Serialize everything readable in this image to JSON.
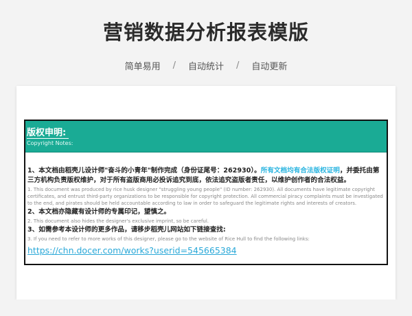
{
  "header": {
    "title": "营销数据分析报表模版",
    "subtitle_items": [
      "简单易用",
      "自动统计",
      "自动更新"
    ],
    "separator": "/"
  },
  "notice": {
    "banner_title": "版权申明:",
    "banner_subtitle": "Copyright Notes:",
    "line1_cn_pre": "1、本文档由稻壳儿设计师\"奋斗的小青年\"制作完成（身份证尾号：262930）。",
    "line1_cn_link": "所有文档均有合法版权证明",
    "line1_cn_post": "，并委托由第三方机构负责版权维护，对于所有盗版商用必投诉追究到底，依法追究盗版者责任，以维护创作者的合法权益。",
    "line1_en": "1. This document was produced by rice husk designer \"struggling young people\" (ID number: 262930). All documents have legitimate copyright certificates, and entrust third-party organizations to be responsible for copyright protection. All commercial piracy complaints must be investigated to the end, and pirates should be held accountable according to law in order to safeguard the legitimate rights and interests of creators.",
    "line2_cn": "2、本文档亦隐藏有设计师的专属印记，望慎之。",
    "line2_en": "2. This document also hides the designer's exclusive imprint, so be careful.",
    "line3_cn": "3、如需参考本设计师的更多作品，请移步稻壳儿网站如下链接查找:",
    "line3_en": "3. If you need to refer to more works of this designer, please go to the website of Rice Hull to find the following links:",
    "url": "https://chn.docer.com/works?userid=545665384"
  }
}
